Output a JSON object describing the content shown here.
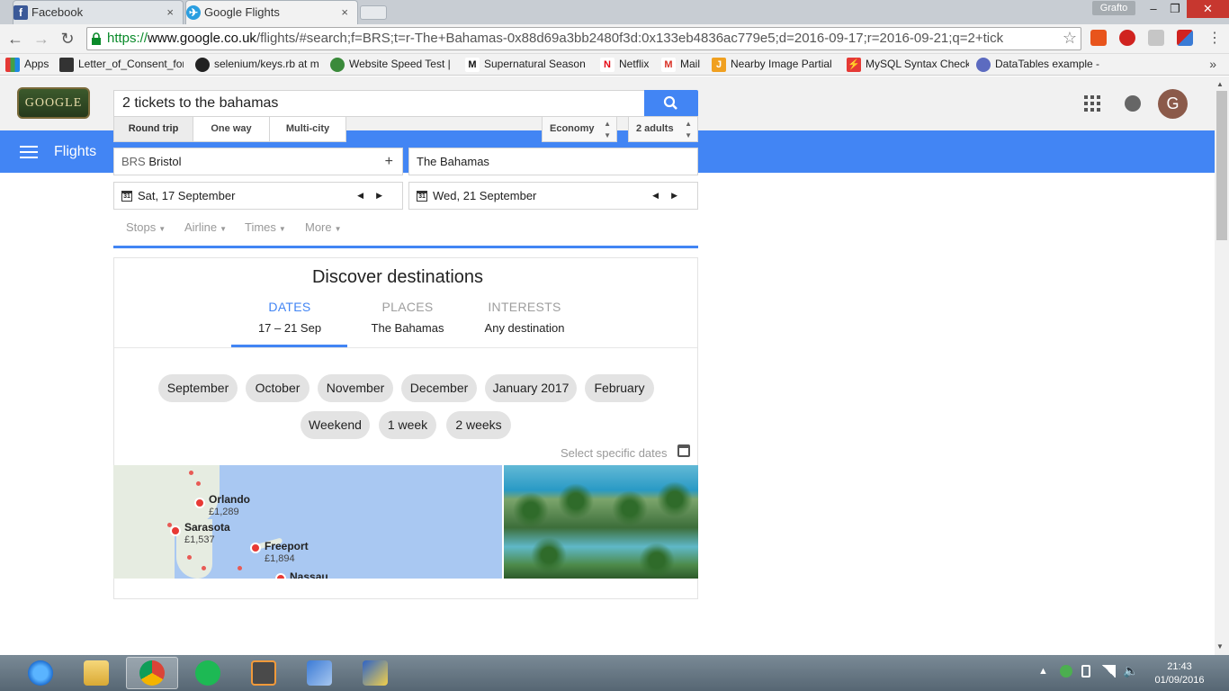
{
  "browser": {
    "tabs": [
      {
        "label": "Facebook",
        "close": "×"
      },
      {
        "label": "Google Flights",
        "close": "×"
      }
    ],
    "profile": "Grafto",
    "window_controls": {
      "minimize": "–",
      "maximize": "❐",
      "close": "✕"
    },
    "url": {
      "scheme": "https://",
      "host": "www.google.co.uk",
      "path": "/flights/#search;f=BRS;t=r-The+Bahamas-0x88d69a3bb2480f3d:0x133eb4836ac779e5;d=2016-09-17;r=2016-09-21;q=2+tick"
    },
    "bookmarks": [
      {
        "label": "Apps"
      },
      {
        "label": "Letter_of_Consent_for"
      },
      {
        "label": "selenium/keys.rb at m"
      },
      {
        "label": "Website Speed Test |"
      },
      {
        "label": "Supernatural Season"
      },
      {
        "label": "Netflix"
      },
      {
        "label": "Mail"
      },
      {
        "label": "Nearby Image Partial"
      },
      {
        "label": "MySQL Syntax Check"
      },
      {
        "label": "DataTables example -"
      }
    ],
    "bookmarks_more": "»"
  },
  "google": {
    "logo_text": "GOOGLE",
    "search_query": "2 tickets to the bahamas",
    "avatar_initial": "G"
  },
  "flights": {
    "title": "Flights",
    "trip_types": [
      "Round trip",
      "One way",
      "Multi-city"
    ],
    "cabin": "Economy",
    "passengers": "2 adults",
    "origin_code": "BRS",
    "origin_city": "Bristol",
    "destination": "The Bahamas",
    "depart_date": "Sat, 17 September",
    "return_date": "Wed, 21 September",
    "cal_num": "31",
    "filters": [
      "Stops",
      "Airline",
      "Times",
      "More"
    ]
  },
  "discover": {
    "title": "Discover destinations",
    "tabs": [
      {
        "heading": "DATES",
        "value": "17 – 21 Sep"
      },
      {
        "heading": "PLACES",
        "value": "The Bahamas"
      },
      {
        "heading": "INTERESTS",
        "value": "Any destination"
      }
    ],
    "months": [
      "September",
      "October",
      "November",
      "December",
      "January 2017",
      "February"
    ],
    "durations": [
      "Weekend",
      "1 week",
      "2 weeks"
    ],
    "specific_dates": "Select specific dates",
    "map_places": [
      {
        "city": "Orlando",
        "price": "£1,289"
      },
      {
        "city": "Sarasota",
        "price": "£1,537"
      },
      {
        "city": "Freeport",
        "price": "£1,894"
      },
      {
        "city": "Nassau"
      }
    ]
  },
  "taskbar": {
    "time": "21:43",
    "date": "01/09/2016"
  }
}
